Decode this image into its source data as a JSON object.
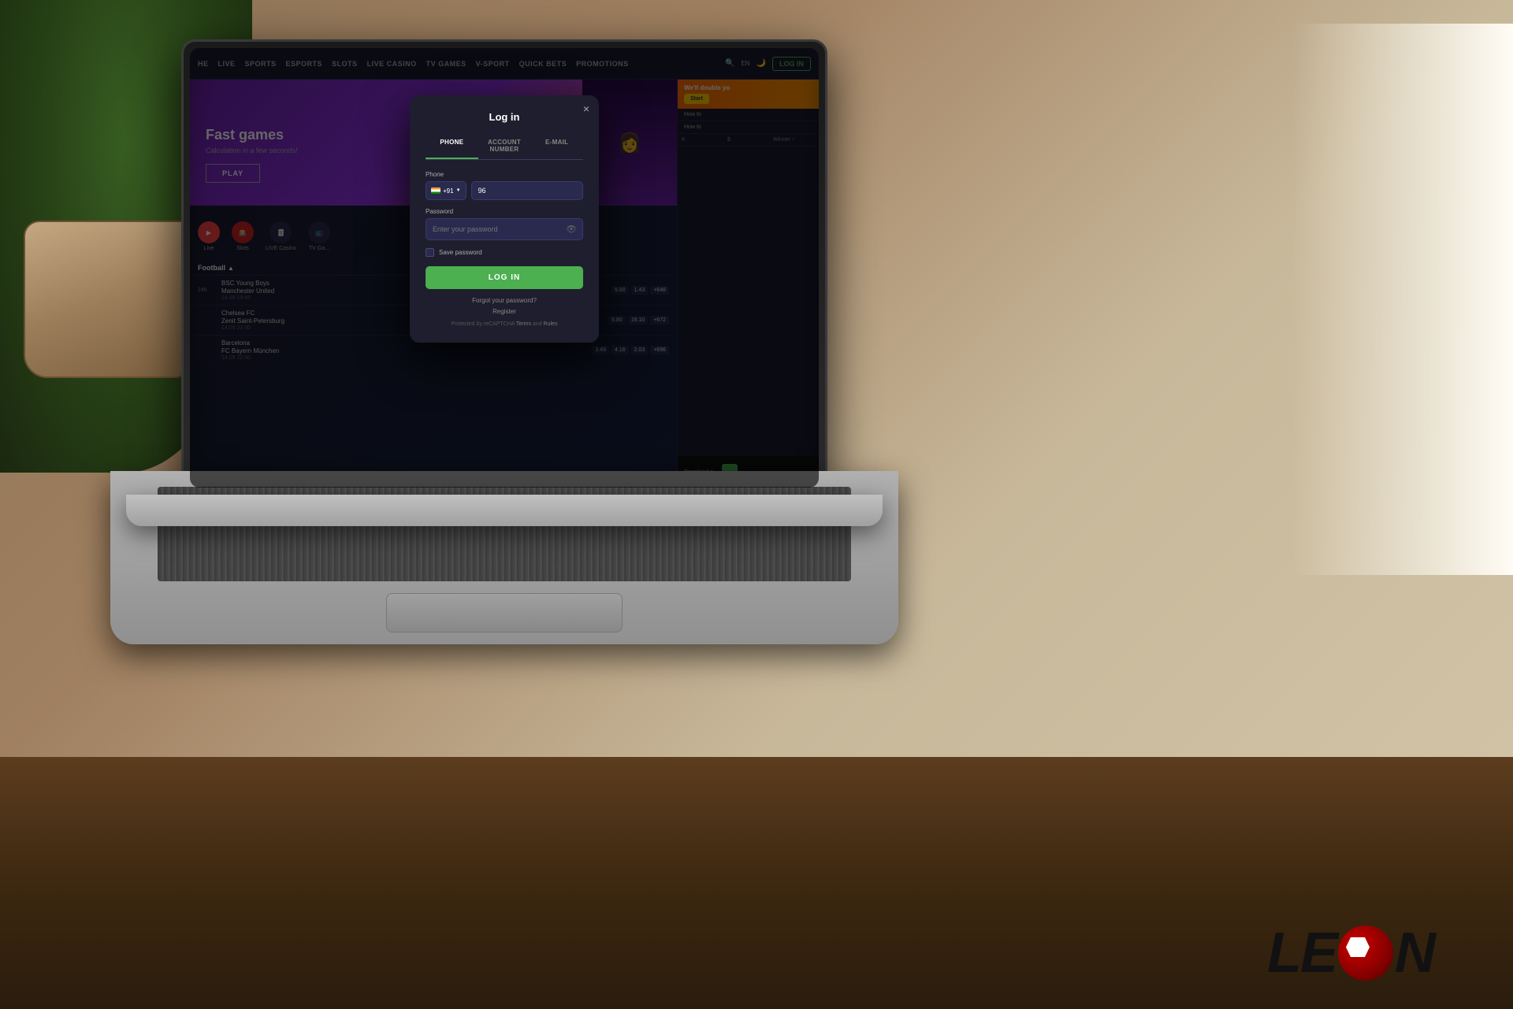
{
  "scene": {
    "bg_color": "#c8b89a"
  },
  "navbar": {
    "items": [
      {
        "label": "HE",
        "active": false
      },
      {
        "label": "LIVE",
        "active": false
      },
      {
        "label": "SPORTS",
        "active": false
      },
      {
        "label": "ESPORTS",
        "active": false
      },
      {
        "label": "SLOTS",
        "active": false
      },
      {
        "label": "LIVE CASINO",
        "active": false
      },
      {
        "label": "TV GAMES",
        "active": false
      },
      {
        "label": "V-SPORT",
        "active": false
      },
      {
        "label": "QUICK BETS",
        "active": false
      },
      {
        "label": "PROMOTIONS",
        "active": false
      }
    ],
    "lang": "EN",
    "login_label": "LOG IN"
  },
  "hero": {
    "title": "Fast games",
    "subtitle": "Calculation in a few seconds!",
    "play_button": "PLAY"
  },
  "sports": [
    {
      "label": "Live",
      "type": "live"
    },
    {
      "label": "Slots",
      "type": "slots"
    },
    {
      "label": "LIVE Casino",
      "type": "live-casino"
    },
    {
      "label": "TV Ga...",
      "type": "tv-games"
    }
  ],
  "football": {
    "header": "Football",
    "matches": [
      {
        "time": "24h",
        "team1": "BSC Young Boys",
        "team2": "Manchester United",
        "date": "14.09 19:45",
        "odds": [
          "5.00",
          "1.43",
          "+648"
        ]
      },
      {
        "time": "",
        "team1": "Chelsea FC",
        "team2": "Zenit Saint-Petersburg",
        "date": "14.09 22:00",
        "odds": [
          "6.80",
          "16.10",
          "+672"
        ]
      },
      {
        "time": "",
        "team1": "Barcelona",
        "team2": "FC Bayern München",
        "date": "14.09 22:00",
        "odds": [
          "3.49",
          "4.16",
          "2.03",
          "+696"
        ]
      }
    ]
  },
  "winner_panel": {
    "title": "We'll double yo",
    "start_label": "Start",
    "howto_items": [
      "How to",
      "How to"
    ],
    "header_cols": [
      "#",
      "$",
      "Winner ↑"
    ]
  },
  "modal": {
    "title": "Log in",
    "close_label": "×",
    "tabs": [
      {
        "label": "PHONE",
        "active": true
      },
      {
        "label": "ACCOUNT NUMBER",
        "active": false
      },
      {
        "label": "E-MAIL",
        "active": false
      }
    ],
    "phone_label": "Phone",
    "country_code": "+91",
    "phone_value": "96",
    "phone_placeholder": "96",
    "password_label": "Password",
    "password_placeholder": "Enter your password",
    "save_password_label": "Save password",
    "login_button": "LOG IN",
    "forgot_password_link": "Forgot your password?",
    "register_link": "Register",
    "recaptcha_text": "Protected by reCAPTCHA",
    "terms_link": "Terms",
    "and_text": "and",
    "rules_link": "Rules"
  },
  "leon_logo": {
    "text_before": "LE",
    "text_after": "N"
  }
}
